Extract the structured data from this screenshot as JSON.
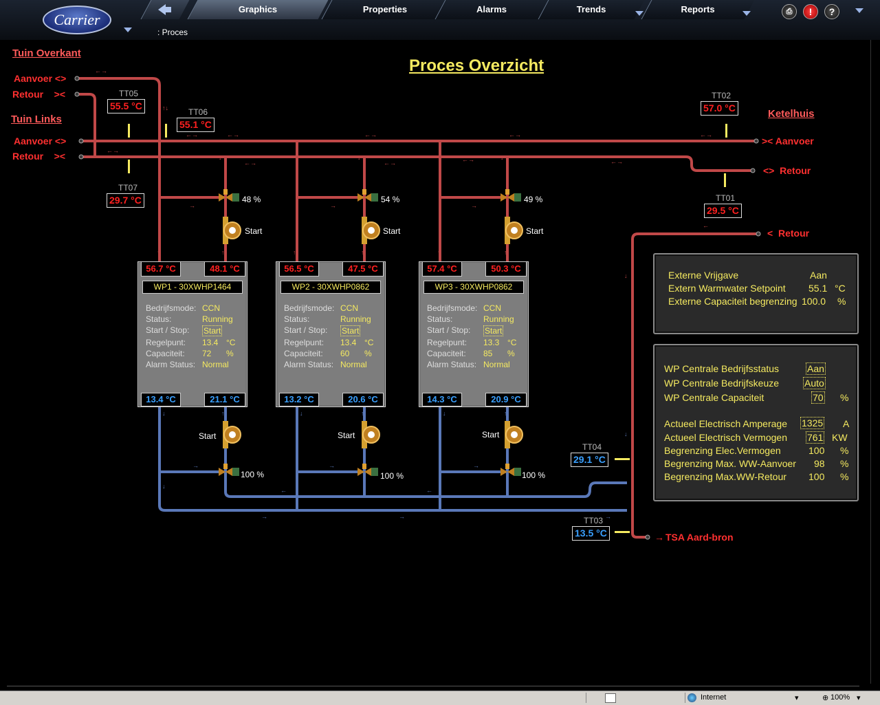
{
  "app": {
    "logo_text": "Carrier"
  },
  "nav": {
    "tabs": [
      "Graphics",
      "Properties",
      "Alarms",
      "Trends",
      "Reports"
    ],
    "active_tab": "Graphics"
  },
  "breadcrumb": ": Proces",
  "page_title": "Proces Overzicht",
  "left_labels": {
    "tuin_overkant": "Tuin Overkant",
    "tuin_links": "Tuin Links",
    "aanvoer1": "Aanvoer <>",
    "retour1": "Retour    ><",
    "aanvoer2": "Aanvoer <>",
    "retour2": "Retour    ><"
  },
  "right_labels": {
    "ketelhuis": "Ketelhuis",
    "aanvoer": ">< Aanvoer",
    "retour": "<>  Retour",
    "retour2": "<  Retour",
    "tsa": "TSA Aard-bron"
  },
  "sensors": {
    "TT05": {
      "label": "TT05",
      "value": "55.5 °C"
    },
    "TT06": {
      "label": "TT06",
      "value": "55.1 °C"
    },
    "TT07": {
      "label": "TT07",
      "value": "29.7 °C"
    },
    "TT02": {
      "label": "TT02",
      "value": "57.0 °C"
    },
    "TT01": {
      "label": "TT01",
      "value": "29.5 °C"
    },
    "TT04": {
      "label": "TT04",
      "value": "29.1 °C"
    },
    "TT03": {
      "label": "TT03",
      "value": "13.5 °C"
    }
  },
  "units": [
    {
      "name": "WP1 - 30XWHP1464",
      "t_in": "56.7 °C",
      "t_out": "48.1 °C",
      "b_in": "13.4 °C",
      "b_out": "21.1 °C",
      "labels": [
        "Bedrijfsmode:",
        "Status:",
        "Start / Stop:",
        "Regelpunt:",
        "Capaciteit:",
        "Alarm Status:"
      ],
      "mode": "CCN",
      "status": "Running",
      "startstop": "Start",
      "regelpunt": "13.4",
      "regel_unit": "°C",
      "capaciteit": "72",
      "cap_unit": "%",
      "alarm": "Normal",
      "valve_top": "48 %",
      "valve_bottom": "100 %",
      "pump_top": "Start",
      "pump_bottom": "Start"
    },
    {
      "name": "WP2 - 30XWHP0862",
      "t_in": "56.5 °C",
      "t_out": "47.5 °C",
      "b_in": "13.2 °C",
      "b_out": "20.6 °C",
      "labels": [
        "Bedrijfsmode:",
        "Status:",
        "Start / Stop:",
        "Regelpunt:",
        "Capaciteit:",
        "Alarm Status:"
      ],
      "mode": "CCN",
      "status": "Running",
      "startstop": "Start",
      "regelpunt": "13.4",
      "regel_unit": "°C",
      "capaciteit": "60",
      "cap_unit": "%",
      "alarm": "Normal",
      "valve_top": "54 %",
      "valve_bottom": "100 %",
      "pump_top": "Start",
      "pump_bottom": "Start"
    },
    {
      "name": "WP3 - 30XWHP0862",
      "t_in": "57.4 °C",
      "t_out": "50.3 °C",
      "b_in": "14.3 °C",
      "b_out": "20.9 °C",
      "labels": [
        "Bedrijfsmode:",
        "Status:",
        "Start / Stop:",
        "Regelpunt:",
        "Capaciteit:",
        "Alarm Status:"
      ],
      "mode": "CCN",
      "status": "Running",
      "startstop": "Start",
      "regelpunt": "13.3",
      "regel_unit": "°C",
      "capaciteit": "85",
      "cap_unit": "%",
      "alarm": "Normal",
      "valve_top": "49 %",
      "valve_bottom": "100 %",
      "pump_top": "Start",
      "pump_bottom": "Start"
    }
  ],
  "panel1": {
    "rows": [
      {
        "label": "Externe Vrijgave",
        "value": "Aan",
        "unit": ""
      },
      {
        "label": "Extern Warmwater Setpoint",
        "value": "55.1",
        "unit": "°C"
      },
      {
        "label": "Externe Capaciteit begrenzing",
        "value": "100.0",
        "unit": "%"
      }
    ]
  },
  "panel2": {
    "rows": [
      {
        "label": "WP Centrale Bedrijfsstatus",
        "value": "Aan",
        "unit": ""
      },
      {
        "label": "WP Centrale Bedrijfskeuze",
        "value": "Auto",
        "unit": ""
      },
      {
        "label": "WP Centrale Capaciteit",
        "value": "70",
        "unit": "%"
      },
      {
        "label": "Actueel Electrisch Amperage",
        "value": "1325",
        "unit": "A"
      },
      {
        "label": "Actueel Electrisch Vermogen",
        "value": "761",
        "unit": "KW"
      },
      {
        "label": "Begrenzing Elec.Vermogen",
        "value": "100",
        "unit": "%"
      },
      {
        "label": "Begrenzing Max. WW-Aanvoer",
        "value": "98",
        "unit": "%"
      },
      {
        "label": "Begrenzing Max.WW-Retour",
        "value": "100",
        "unit": "%"
      }
    ]
  },
  "statusbar": {
    "zone": "Internet",
    "zoom": "100%"
  },
  "colors": {
    "hot_pipe": "#c04848",
    "cold_pipe": "#5a78b8",
    "label_yellow": "#f5ea60",
    "temp_red": "#ff2020",
    "temp_blue": "#3aa0ff"
  }
}
